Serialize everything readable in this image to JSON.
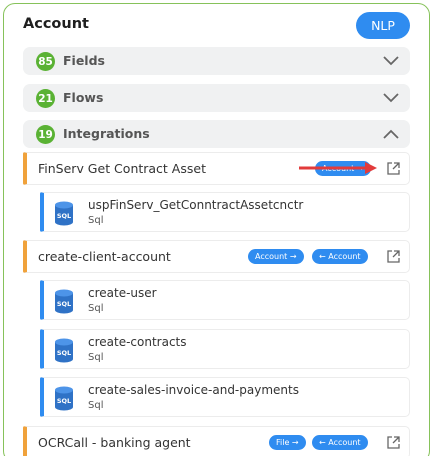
{
  "panel": {
    "title": "Account",
    "nlp_button": "NLP"
  },
  "sections": {
    "fields": {
      "count": "85",
      "label": "Fields",
      "chevron": "chevron-down-icon"
    },
    "flows": {
      "count": "21",
      "label": "Flows",
      "chevron": "chevron-down-icon"
    },
    "integrations": {
      "count": "19",
      "label": "Integrations",
      "chevron": "chevron-up-icon"
    }
  },
  "integrations": [
    {
      "name": "FinServ Get Contract Asset",
      "tags": [
        "Account →"
      ],
      "children": [
        {
          "name": "uspFinServ_GetConntractAssetcnctr",
          "type": "Sql"
        }
      ]
    },
    {
      "name": "create-client-account",
      "tags": [
        "Account →",
        "← Account"
      ],
      "children": [
        {
          "name": "create-user",
          "type": "Sql"
        },
        {
          "name": "create-contracts",
          "type": "Sql"
        },
        {
          "name": "create-sales-invoice-and-payments",
          "type": "Sql"
        }
      ]
    },
    {
      "name": "OCRCall - banking agent",
      "tags": [
        "File →",
        "← Account"
      ],
      "children": []
    }
  ],
  "db_icon_label": "SQL",
  "colors": {
    "accent_blue": "#2f8cf0",
    "count_green": "#5ab234",
    "asset_orange": "#f0a23b",
    "panel_border": "#86c25a",
    "annotation_red": "#e23b3b"
  }
}
